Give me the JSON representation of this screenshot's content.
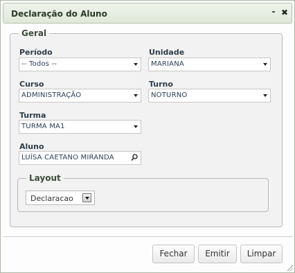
{
  "dialog": {
    "title": "Declaração do Aluno",
    "minimize_icon": "⁃",
    "close_icon": "✖"
  },
  "geral": {
    "legend": "Geral",
    "periodo": {
      "label": "Período",
      "value": "-- Todos --"
    },
    "unidade": {
      "label": "Unidade",
      "value": "MARIANA"
    },
    "curso": {
      "label": "Curso",
      "value": "ADMINISTRAÇÃO"
    },
    "turno": {
      "label": "Turno",
      "value": "NOTURNO"
    },
    "turma": {
      "label": "Turma",
      "value": "TURMA MA1"
    },
    "aluno": {
      "label": "Aluno",
      "value": "LUÍSA CAETANO MIRANDA",
      "icon": "search-icon"
    }
  },
  "layout": {
    "legend": "Layout",
    "value": "Declaracao"
  },
  "footer": {
    "close_label": "Fechar",
    "emit_label": "Emitir",
    "clear_label": "Limpar"
  }
}
